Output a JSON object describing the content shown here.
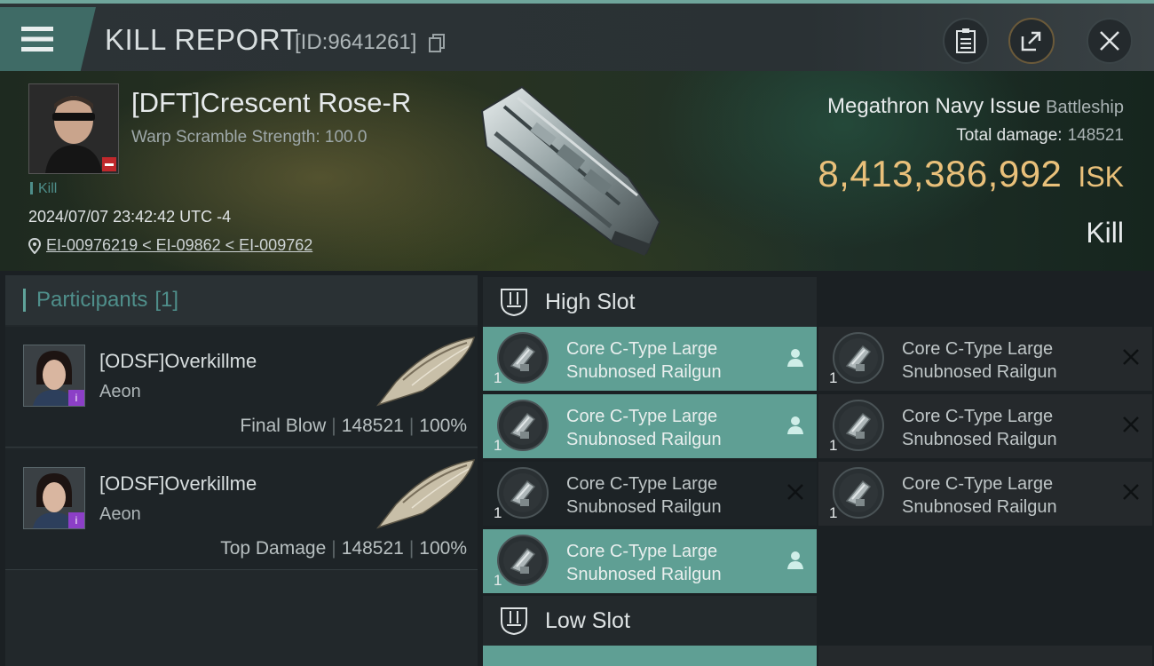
{
  "header": {
    "title": "KILL REPORT",
    "report_id": "[ID:9641261]"
  },
  "victim": {
    "name": "[DFT]Crescent Rose-R",
    "warp_scramble": "Warp Scramble Strength: 100.0",
    "tag": "Kill",
    "datetime": "2024/07/07 23:42:42 UTC -4",
    "location": "EI-00976219 < EI-09862 < EI-009762",
    "ship_name": "Megathron Navy Issue",
    "ship_class": "Battleship",
    "total_damage_label": "Total damage:",
    "total_damage": "148521",
    "isk_value": "8,413,386,992",
    "isk_unit": "ISK",
    "result": "Kill"
  },
  "participants": {
    "title": "Participants",
    "count": "[1]",
    "rows": [
      {
        "name": "[ODSF]Overkillme",
        "corp": "Aeon",
        "role": "Final Blow",
        "damage": "148521",
        "percent": "100%"
      },
      {
        "name": "[ODSF]Overkillme",
        "corp": "Aeon",
        "role": "Top Damage",
        "damage": "148521",
        "percent": "100%"
      }
    ]
  },
  "slots": {
    "high_title": "High Slot",
    "low_title": "Low Slot",
    "high_modules": [
      {
        "line1": "Core C-Type Large",
        "line2": "Snubnosed Railgun",
        "qty": "1",
        "status": "dropped"
      },
      {
        "line1": "Core C-Type Large",
        "line2": "Snubnosed Railgun",
        "qty": "1",
        "status": "destroyed"
      },
      {
        "line1": "Core C-Type Large",
        "line2": "Snubnosed Railgun",
        "qty": "1",
        "status": "dropped"
      },
      {
        "line1": "Core C-Type Large",
        "line2": "Snubnosed Railgun",
        "qty": "1",
        "status": "destroyed"
      },
      {
        "line1": "Core C-Type Large",
        "line2": "Snubnosed Railgun",
        "qty": "1",
        "status": "destroyed"
      },
      {
        "line1": "Core C-Type Large",
        "line2": "Snubnosed Railgun",
        "qty": "1",
        "status": "destroyed"
      },
      {
        "line1": "Core C-Type Large",
        "line2": "Snubnosed Railgun",
        "qty": "1",
        "status": "dropped"
      }
    ]
  },
  "colors": {
    "accent": "#5f9f94",
    "isk": "#e9c07a",
    "participants_title": "#4f8f8b"
  }
}
